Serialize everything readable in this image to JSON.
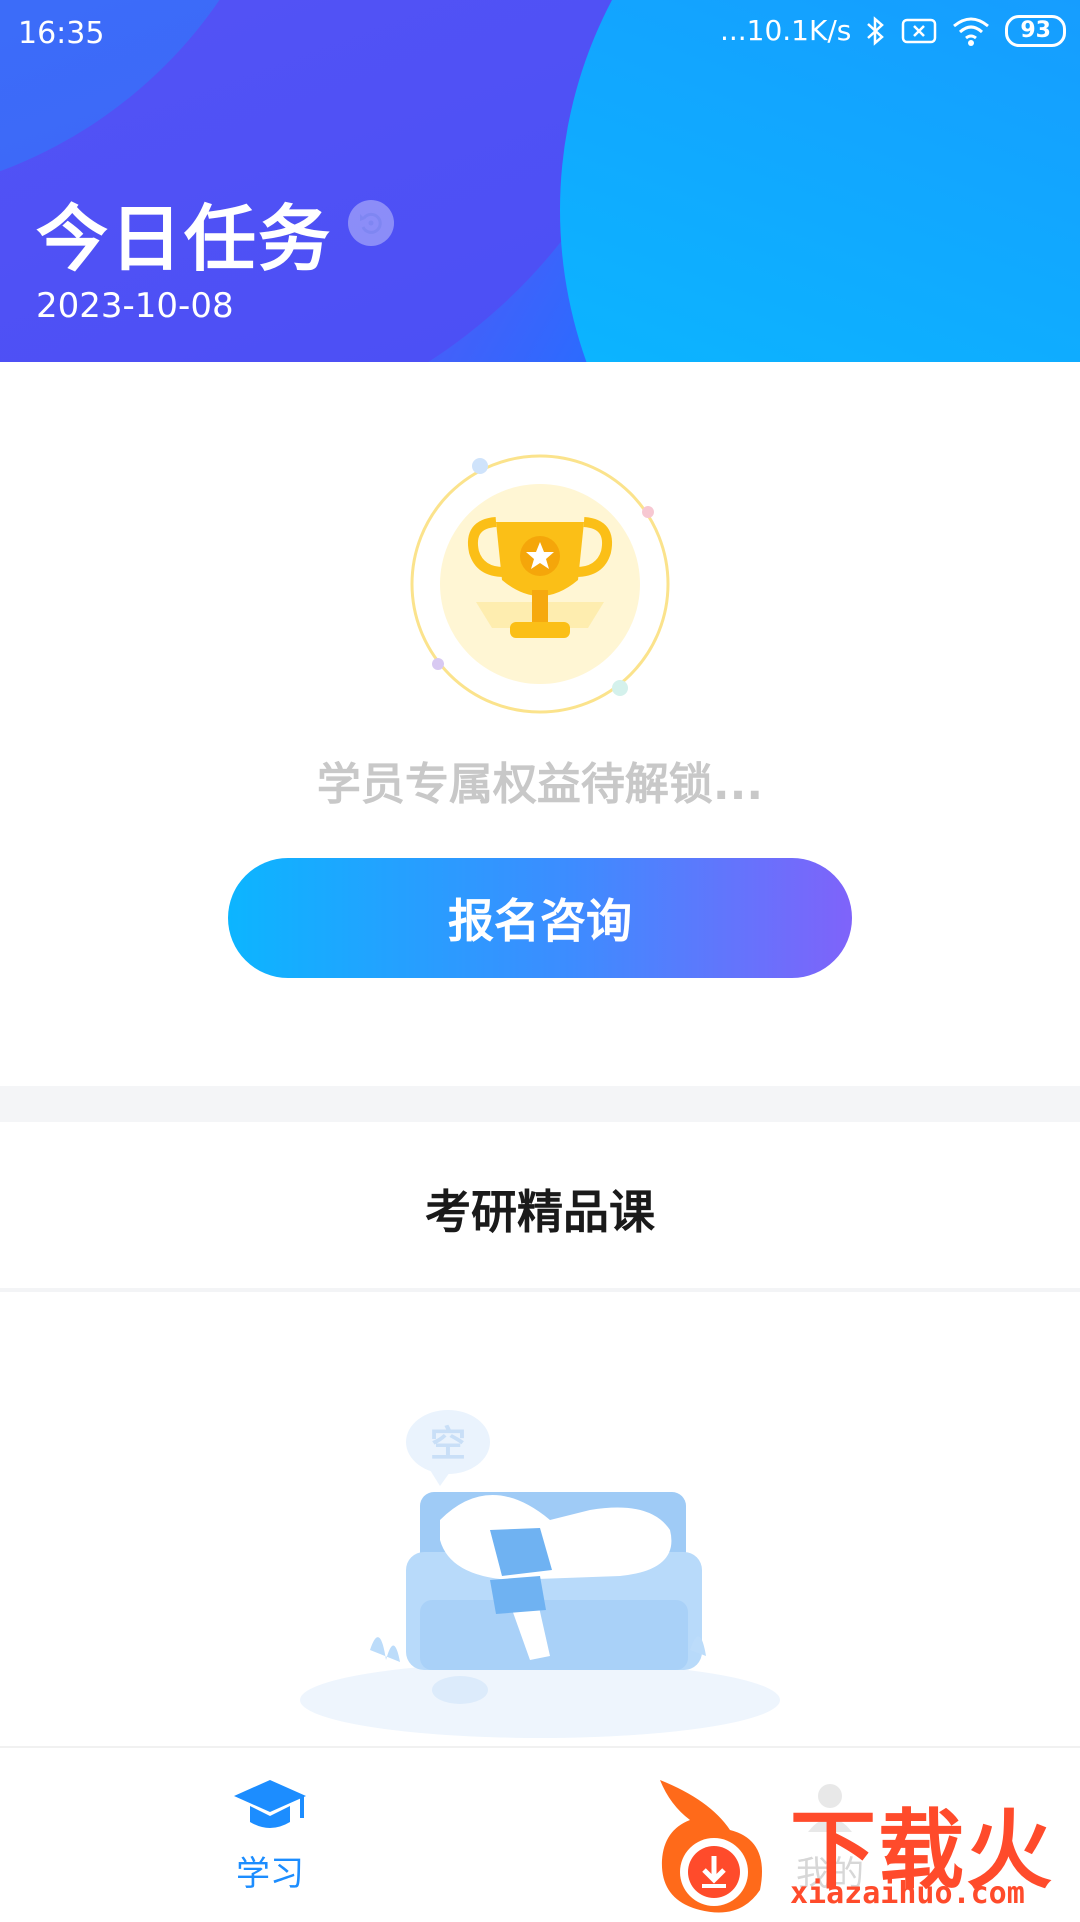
{
  "status_bar": {
    "time": "16:35",
    "network_speed": "...10.1K/s",
    "battery": "93"
  },
  "header": {
    "title": "今日任务",
    "date": "2023-10-08"
  },
  "benefits": {
    "locked_text": "学员专属权益待解锁...",
    "cta_label": "报名咨询"
  },
  "section": {
    "title": "考研精品课",
    "empty_bubble": "空"
  },
  "tabbar": {
    "items": [
      {
        "label": "学习",
        "icon": "graduation-cap-icon",
        "active": true
      },
      {
        "label": "我的",
        "icon": "user-icon",
        "active": false
      }
    ]
  },
  "watermark": {
    "brand": "下载火",
    "url": "xiazaihuo.com"
  },
  "colors": {
    "accent": "#1c8dff",
    "cta_start": "#0cb5ff",
    "cta_end": "#7f63fa",
    "watermark": "#ff4b2b"
  }
}
